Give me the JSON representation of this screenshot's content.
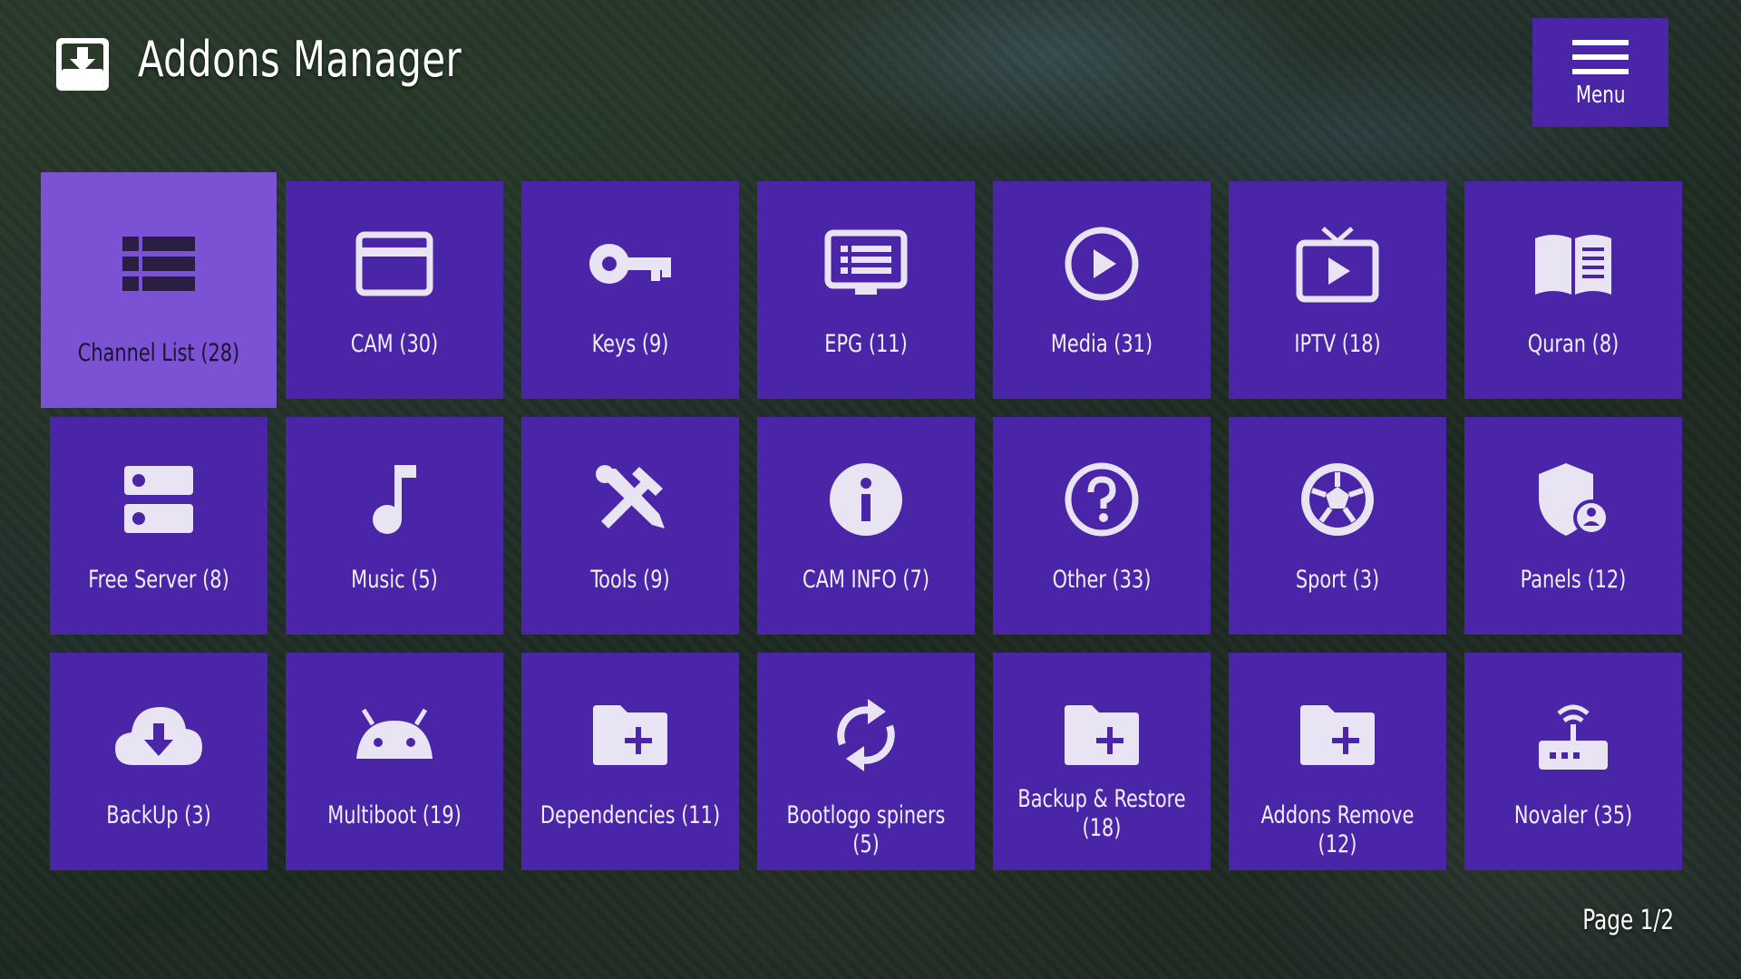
{
  "header": {
    "title": "Addons Manager",
    "icon": "download-box-icon"
  },
  "menu": {
    "label": "Menu",
    "icon": "hamburger-icon"
  },
  "theme": {
    "tile_color": "#4b25a7",
    "selected_tile_color": "#7a52d3",
    "icon_color": "#ffffff"
  },
  "tiles": [
    {
      "label": "Channel List (28)",
      "icon": "list-icon"
    },
    {
      "label": "CAM (30)",
      "icon": "card-icon"
    },
    {
      "label": "Keys (9)",
      "icon": "key-icon"
    },
    {
      "label": "EPG (11)",
      "icon": "epg-screen-icon"
    },
    {
      "label": "Media (31)",
      "icon": "play-circle-icon"
    },
    {
      "label": "IPTV (18)",
      "icon": "tv-play-icon"
    },
    {
      "label": "Quran (8)",
      "icon": "book-icon"
    },
    {
      "label": "Free Server (8)",
      "icon": "server-icon"
    },
    {
      "label": "Music (5)",
      "icon": "music-note-icon"
    },
    {
      "label": "Tools (9)",
      "icon": "tools-icon"
    },
    {
      "label": "CAM INFO (7)",
      "icon": "info-icon"
    },
    {
      "label": "Other (33)",
      "icon": "help-circle-icon"
    },
    {
      "label": "Sport (3)",
      "icon": "soccer-ball-icon"
    },
    {
      "label": "Panels (12)",
      "icon": "shield-account-icon"
    },
    {
      "label": "BackUp (3)",
      "icon": "cloud-download-icon"
    },
    {
      "label": "Multiboot (19)",
      "icon": "android-icon"
    },
    {
      "label": "Dependencies (11)",
      "icon": "folder-plus-icon"
    },
    {
      "label": "Bootlogo spiners (5)",
      "icon": "sync-icon"
    },
    {
      "label": "Backup & Restore (18)",
      "icon": "folder-plus-icon"
    },
    {
      "label": "Addons Remove (12)",
      "icon": "folder-plus-icon"
    },
    {
      "label": "Novaler (35)",
      "icon": "router-wifi-icon"
    }
  ],
  "pagination": {
    "label": "Page 1/2"
  }
}
